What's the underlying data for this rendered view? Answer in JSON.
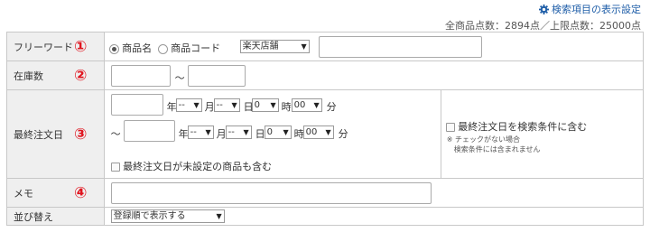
{
  "header": {
    "settings_link": "検索項目の表示設定",
    "totals": "全商品点数：2894点／上限点数：25000点"
  },
  "rows": {
    "freeword": {
      "label": "フリーワード",
      "number": "①",
      "radio_product_name": "商品名",
      "radio_product_code": "商品コード",
      "store_select": "楽天店舗",
      "keyword_value": ""
    },
    "stock": {
      "label": "在庫数",
      "number": "②",
      "from_value": "",
      "tilde": "～",
      "to_value": ""
    },
    "last_order": {
      "label": "最終注文日",
      "number": "③",
      "year_label": "年",
      "month_label": "月",
      "day_label": "日",
      "hour_label": "時",
      "minute_label": "分",
      "tilde": "～",
      "month_select": "--",
      "day_select": "--",
      "day_num_select": "0",
      "minute_select": "00",
      "include_unset": "最終注文日が未設定の商品も含む",
      "include_in_criteria": "最終注文日を検索条件に含む",
      "note_line1": "※ チェックがない場合",
      "note_line2": "検索条件には含まれません"
    },
    "memo": {
      "label": "メモ",
      "number": "④",
      "value": ""
    },
    "sort": {
      "label": "並び替え",
      "select": "登録順で表示する"
    }
  },
  "colors": {
    "accent_number": "#e0141e",
    "link": "#1f5ea8",
    "label_bg": "#efefef"
  }
}
